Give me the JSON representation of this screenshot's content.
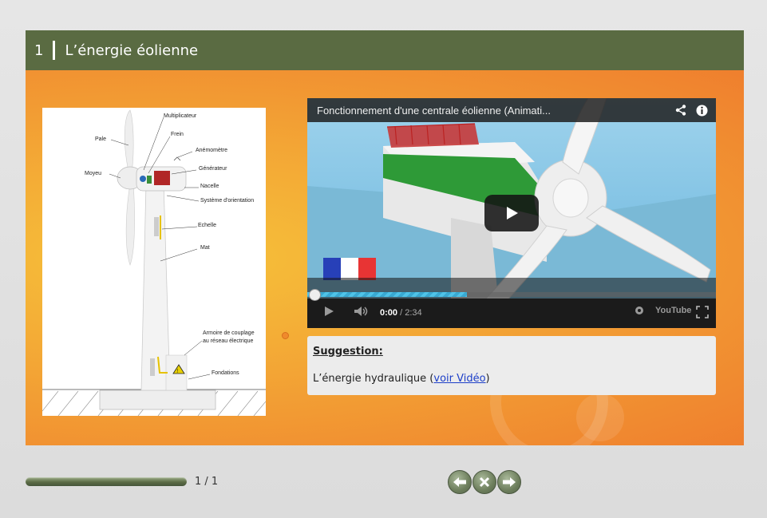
{
  "header": {
    "number": "1",
    "title": "L’énergie éolienne"
  },
  "diagram": {
    "labels": {
      "multiplicateur": "Multiplicateur",
      "frein": "Frein",
      "pale": "Pale",
      "anemometre": "Anémomètre",
      "generateur": "Générateur",
      "moyeu": "Moyeu",
      "nacelle": "Nacelle",
      "systeme": "Système d'orientation",
      "echelle": "Echelle",
      "mat": "Mat",
      "armoire1": "Armoire de couplage",
      "armoire2": "au réseau électrique",
      "fondations": "Fondations"
    }
  },
  "video": {
    "title": "Fonctionnement d'une centrale éolienne (Animati...",
    "current_time": "0:00",
    "duration": "/ 2:34",
    "brand": "YouTube",
    "buffered_fraction": 0.39,
    "icons": [
      "share-icon",
      "info-icon",
      "play-icon",
      "volume-icon",
      "settings-icon",
      "fullscreen-icon"
    ]
  },
  "suggestion": {
    "heading": "Suggestion:",
    "text": "L’énergie hydraulique (",
    "link": "voir Vidéo",
    "text_end": ")"
  },
  "footer": {
    "page_count": "1 / 1",
    "progress_fraction": 1.0,
    "nav": [
      "previous-icon",
      "close-icon",
      "next-icon"
    ]
  },
  "colors": {
    "header": "#5a6b42",
    "accent_orange": "#f3a535",
    "link": "#1c3ec8"
  }
}
